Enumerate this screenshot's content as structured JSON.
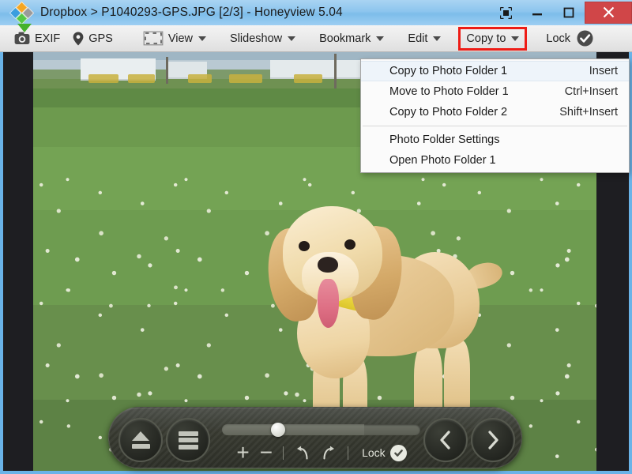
{
  "window": {
    "app_name": "Honeyview",
    "version": "5.04",
    "title": "Dropbox > P1040293-GPS.JPG [2/3] - Honeyview 5.04",
    "breadcrumb_root": "Dropbox",
    "file_name": "P1040293-GPS.JPG",
    "page_indicator": "[2/3]",
    "logo_icon": "dropbox-diamonds-icon",
    "buttons": {
      "fullscreen_label": "⬚",
      "minimize_label": "–",
      "maximize_label": "□",
      "close_label": "✕"
    },
    "close_color": "#d04648",
    "titlebar_color": "#8dc5ee"
  },
  "toolbar": {
    "items": [
      {
        "label": "EXIF",
        "icon": "camera-icon",
        "caret": false
      },
      {
        "label": "GPS",
        "icon": "map-pin-icon",
        "caret": false
      },
      {
        "label": "View",
        "icon": "crop-frame-icon",
        "caret": true
      },
      {
        "label": "Slideshow",
        "icon": "",
        "caret": true
      },
      {
        "label": "Bookmark",
        "icon": "",
        "caret": true
      },
      {
        "label": "Edit",
        "icon": "",
        "caret": true
      },
      {
        "label": "Copy to",
        "icon": "",
        "caret": true
      },
      {
        "label": "Lock",
        "icon": "check-circle-icon",
        "caret": false
      }
    ],
    "highlight_item": "Copy to",
    "highlight_color": "#ee1c16"
  },
  "menu": {
    "open_for": "Copy to",
    "groups": [
      {
        "items": [
          {
            "label": "Copy to Photo Folder 1",
            "shortcut": "Insert",
            "selected": true
          },
          {
            "label": "Move to Photo Folder 1",
            "shortcut": "Ctrl+Insert",
            "selected": false
          },
          {
            "label": "Copy to Photo Folder 2",
            "shortcut": "Shift+Insert",
            "selected": false
          }
        ]
      },
      {
        "items": [
          {
            "label": "Photo Folder Settings",
            "shortcut": "",
            "selected": false
          },
          {
            "label": "Open Photo Folder 1",
            "shortcut": "",
            "selected": false
          }
        ]
      }
    ]
  },
  "controlbar": {
    "eject_icon": "eject-icon",
    "menu_icon": "hamburger-menu-icon",
    "prev_icon": "chevron-left-icon",
    "next_icon": "chevron-right-icon",
    "zoom_in_label": "+",
    "zoom_out_label": "−",
    "rotate_ccw_icon": "rotate-counterclockwise-icon",
    "rotate_cw_icon": "rotate-clockwise-icon",
    "lock_label": "Lock",
    "lock_icon": "check-circle-icon",
    "slider_position_percent": 27
  },
  "image": {
    "alt": "golden cocker spaniel puppy standing in clover-covered grass field",
    "background_color": "#1e1e22"
  }
}
